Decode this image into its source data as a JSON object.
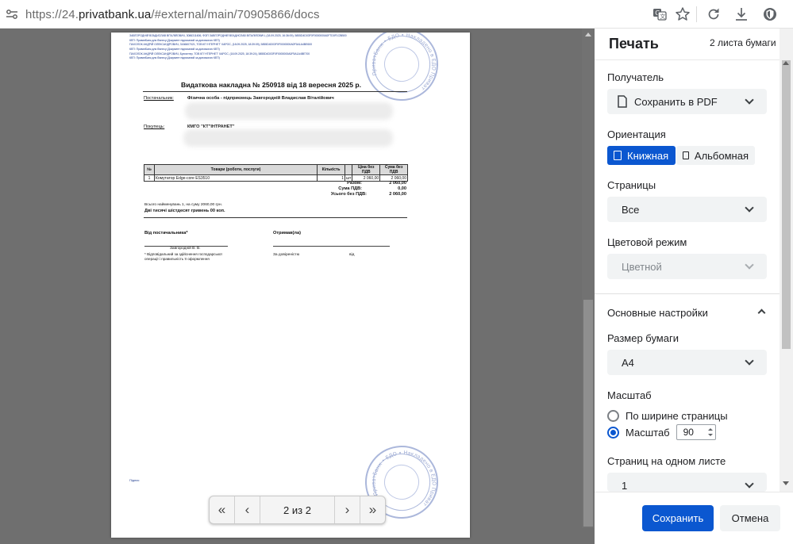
{
  "browser": {
    "url_scheme": "https://24.",
    "url_host": "privatbank.ua",
    "url_path": "/#external/main/70905866/docs"
  },
  "document": {
    "header_lines": [
      "ЗАВГОРОДНІЙ ВЛАДИСЛАВ ВІТАЛІЙОВИЧ, 3086311606, ФОП ЗАВГОРОДНІЙ ВЛАДИСЛАВ ВІТАЛІЙОВИЧ, (18.09.2025, 16:36:09), 5855D4D03F0F0000000A0F7D0F1CBB00",
      "КЕП: ПриватБанк для бізнесу (Документ підписаний за допомогою КЕП)",
      "ПАХОЛОК АНДРІЙ ОЛЕКСАНДРОВИЧ, 3166607021, ТОВ КП 'НТЕРНЕТ' ХАРОС, (18.09.2025, 18:39:09), 5855D4D03F0F0000000A0F5A1A4BE600",
      "КЕП: ПриватБанк для бізнесу (Документ підписаний за допомогою КЕП)",
      "ПАХОЛОК АНДРІЙ ОЛЕКСАНДРОВИЧ, Бухгалтер, ТОВ КП 'НТЕРНЕТ' ХАРОС, (18.09.2025, 18:39:24), 5855D4D03F0F0000000A0F5A1A4BE700",
      "КЕП: ПриватБанк для бізнесу (Документ підписаний за допомогою КЕП)"
    ],
    "title": "Видаткова накладна № 250918 від 18 вересня 2025 р.",
    "supplier_label": "Постачальник:",
    "supplier_value": "Фізична особа - підприємець Завгородній Владислав Віталійович",
    "buyer_label": "Покупець:",
    "buyer_value": "КМГО \"КТ\"ІНТРАНЕТ\"",
    "table_headers": [
      "№",
      "Товари (роботи, послуги)",
      "Кількість",
      "",
      "Ціна без ПДВ",
      "Сума без ПДВ"
    ],
    "table_rows": [
      [
        "1",
        "Комутатор Edge-core ES3510",
        "1",
        "шт",
        "2 060,00",
        "2 060,00"
      ]
    ],
    "totals": [
      {
        "label": "Разом:",
        "value": "2 060,00"
      },
      {
        "label": "Сума ПДВ:",
        "value": "0,00"
      },
      {
        "label": "Усього без ПДВ:",
        "value": "2 060,00"
      }
    ],
    "summary_line": "Всього найменувань 1, на суму 2060,00 грн.",
    "summary_words": "Дві тисячі шістдесят гривень 00 коп.",
    "from_supplier": "Від постачальника*",
    "received": "Отримав(ла)",
    "signer_name": "Завгородній В. В.",
    "footnote": "* Відповідальний за здійснення господарської операції і правильність її оформлення",
    "proxy": "За довіреністю",
    "from_word": "від",
    "signature_word": "Підпис",
    "stamp_text": "ПриватБанк • ЕДО • Накладено в ЕДО Приват"
  },
  "page_nav": {
    "first": "«",
    "prev": "‹",
    "label": "2 из 2",
    "next": "›",
    "last": "»"
  },
  "print_panel": {
    "title": "Печать",
    "sheets": "2 листа бумаги",
    "destination_label": "Получатель",
    "destination_value": "Сохранить в PDF",
    "orientation_label": "Ориентация",
    "orientation_portrait": "Книжная",
    "orientation_landscape": "Альбомная",
    "pages_label": "Страницы",
    "pages_value": "Все",
    "color_label": "Цветовой режим",
    "color_value": "Цветной",
    "more_settings": "Основные настройки",
    "paper_size_label": "Размер бумаги",
    "paper_size_value": "A4",
    "scale_label": "Масштаб",
    "scale_fit": "По ширине страницы",
    "scale_custom": "Масштаб",
    "scale_value": "90",
    "pages_per_sheet_label": "Страниц на одном листе",
    "pages_per_sheet_value": "1",
    "save_button": "Сохранить",
    "cancel_button": "Отмена"
  },
  "colors": {
    "accent": "#0b57d0",
    "preview_bg": "#6f6f6f",
    "stamp": "#8fa0cf"
  }
}
